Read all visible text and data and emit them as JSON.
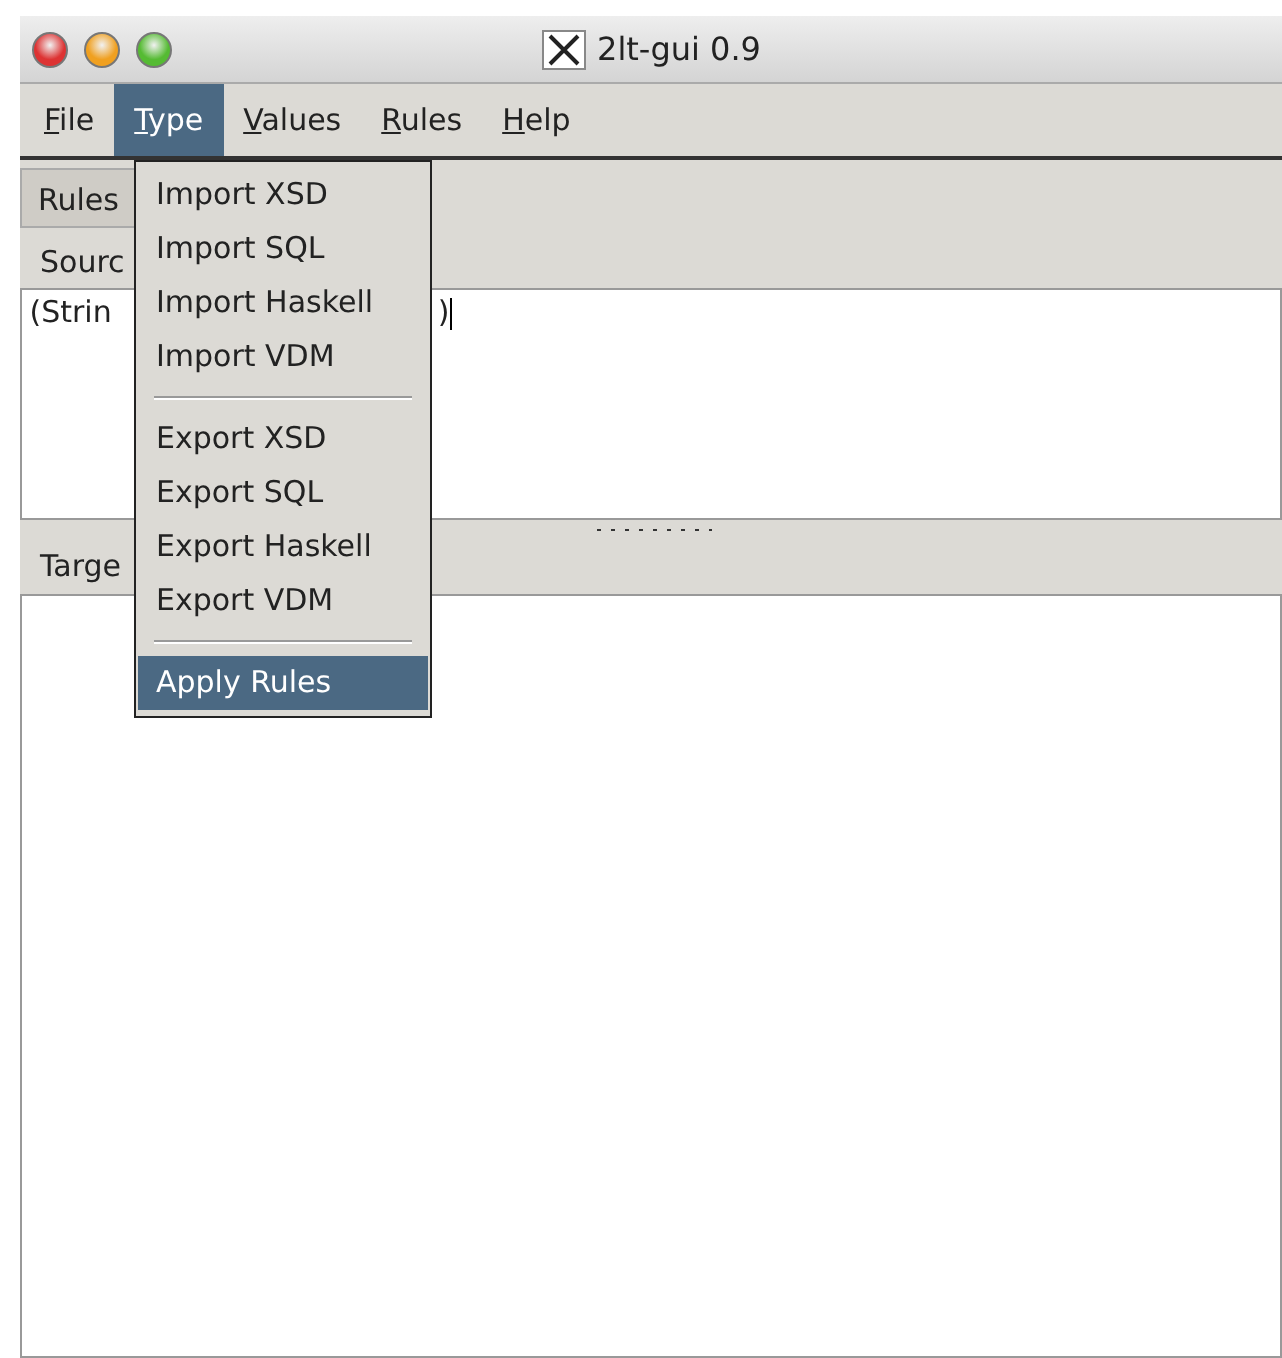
{
  "window": {
    "title": "2lt-gui 0.9"
  },
  "menubar": [
    {
      "label": "File",
      "selected": false,
      "mnemonic": true
    },
    {
      "label": "Type",
      "selected": true,
      "mnemonic": true
    },
    {
      "label": "Values",
      "selected": false,
      "mnemonic": true
    },
    {
      "label": "Rules",
      "selected": false,
      "mnemonic": true
    },
    {
      "label": "Help",
      "selected": false,
      "mnemonic": true
    }
  ],
  "tabs": [
    {
      "label": "Rules",
      "selected": true
    }
  ],
  "source": {
    "label": "Sourc",
    "text_start": "(Strin",
    "text_end": ")"
  },
  "target": {
    "label": "Targe"
  },
  "menu": [
    {
      "kind": "item",
      "label": "Import XSD",
      "selected": false
    },
    {
      "kind": "item",
      "label": "Import SQL",
      "selected": false
    },
    {
      "kind": "item",
      "label": "Import Haskell",
      "selected": false
    },
    {
      "kind": "item",
      "label": "Import VDM",
      "selected": false
    },
    {
      "kind": "separator"
    },
    {
      "kind": "item",
      "label": "Export XSD",
      "selected": false
    },
    {
      "kind": "item",
      "label": "Export SQL",
      "selected": false
    },
    {
      "kind": "item",
      "label": "Export Haskell",
      "selected": false
    },
    {
      "kind": "item",
      "label": "Export VDM",
      "selected": false
    },
    {
      "kind": "separator"
    },
    {
      "kind": "item",
      "label": "Apply Rules",
      "selected": true
    }
  ]
}
